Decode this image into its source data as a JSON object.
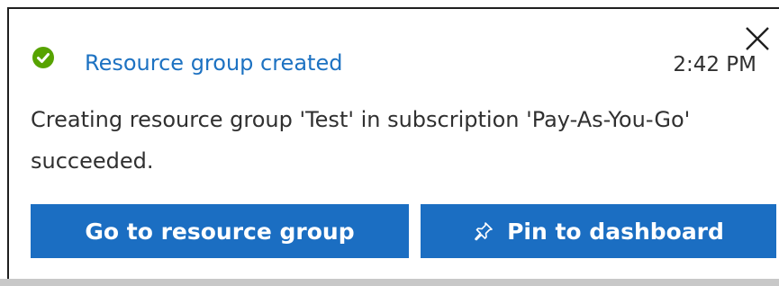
{
  "notification": {
    "title": "Resource group created",
    "time": "2:42 PM",
    "message": "Creating resource group 'Test' in subscription 'Pay-As-You-Go' succeeded.",
    "status_icon": "success-check-icon",
    "close_icon": "close-icon",
    "status_color": "#57a300",
    "accent_color": "#1b6ec2"
  },
  "actions": {
    "go_to_label": "Go to resource group",
    "pin_label": "Pin to dashboard",
    "pin_icon": "pin-icon"
  }
}
